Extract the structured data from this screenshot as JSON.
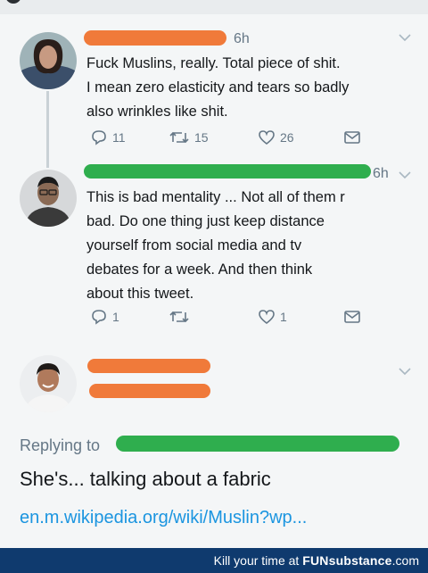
{
  "tweets": [
    {
      "time": "6h",
      "text_lines": [
        "Fuck Muslins, really. Total piece of shit.",
        "I mean zero elasticity and tears so badly",
        "also wrinkles like shit."
      ],
      "replies": "11",
      "retweets": "15",
      "likes": "26"
    },
    {
      "time": "6h",
      "text_lines": [
        "This is bad mentality ... Not all of them r",
        "bad. Do one thing just keep distance",
        "yourself from social media and tv",
        "debates for a week. And then think",
        "about this tweet."
      ],
      "replies": "1",
      "retweets": "",
      "likes": "1"
    }
  ],
  "reply": {
    "replying_to": "Replying to",
    "text": "She's... talking about a fabric",
    "link": "en.m.wikipedia.org/wiki/Muslin?wp..."
  },
  "footer": {
    "prefix": "Kill your time at ",
    "brand_a": "FUN",
    "brand_b": "substance",
    "suffix": ".com"
  },
  "colors": {
    "redact_orange": "#f07a3a",
    "redact_green": "#2fae4e",
    "link_blue": "#1b95e0",
    "footer_bg": "#0f3a6e"
  }
}
